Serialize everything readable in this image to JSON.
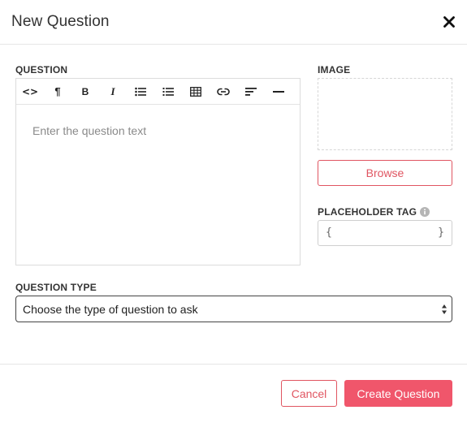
{
  "modal": {
    "title": "New Question",
    "close_icon": "close-icon"
  },
  "question": {
    "label": "QUESTION",
    "placeholder": "Enter the question text",
    "toolbar": [
      {
        "name": "code-view-icon",
        "glyph": "<>"
      },
      {
        "name": "paragraph-icon",
        "glyph": "¶"
      },
      {
        "name": "bold-icon",
        "glyph": "B"
      },
      {
        "name": "italic-icon",
        "glyph": "I"
      },
      {
        "name": "bullet-list-icon"
      },
      {
        "name": "numbered-list-icon"
      },
      {
        "name": "table-icon"
      },
      {
        "name": "link-icon"
      },
      {
        "name": "align-icon"
      },
      {
        "name": "horizontal-rule-icon"
      }
    ]
  },
  "image": {
    "label": "IMAGE",
    "browse_label": "Browse"
  },
  "placeholder_tag": {
    "label": "PLACEHOLDER TAG",
    "open_brace": "{",
    "close_brace": "}",
    "value": ""
  },
  "question_type": {
    "label": "QUESTION TYPE",
    "selected": "Choose the type of question to ask"
  },
  "footer": {
    "cancel_label": "Cancel",
    "create_label": "Create Question"
  },
  "colors": {
    "accent": "#e05561",
    "primary_button": "#f0566b"
  }
}
